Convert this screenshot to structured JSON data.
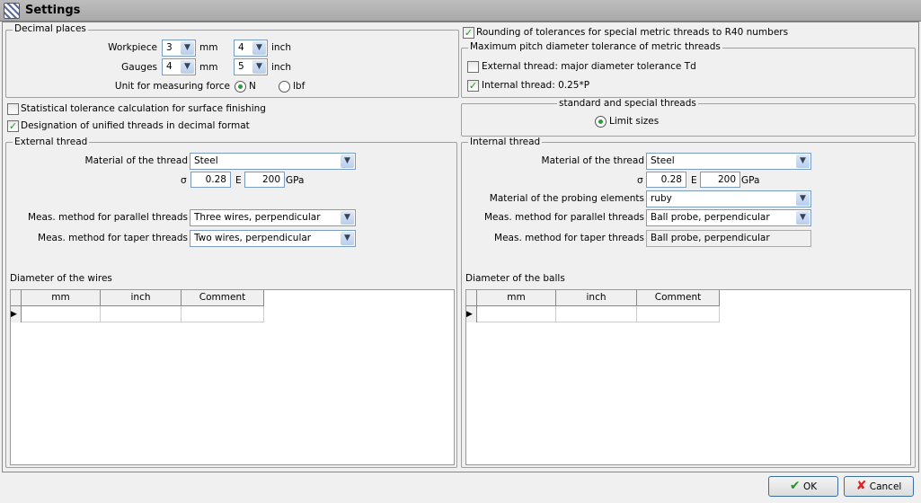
{
  "window": {
    "title": "Settings"
  },
  "decimal": {
    "legend": "Decimal places",
    "workpiece_label": "Workpiece",
    "workpiece_mm": "3",
    "workpiece_inch": "4",
    "gauges_label": "Gauges",
    "gauges_mm": "4",
    "gauges_inch": "5",
    "mm": "mm",
    "inch": "inch",
    "force_label": "Unit for measuring force",
    "force_n": "N",
    "force_lbf": "lbf",
    "force_selected": "N"
  },
  "options": {
    "statistical": "Statistical tolerance calculation for surface finishing",
    "statistical_checked": false,
    "unified": "Designation of unified threads in decimal format",
    "unified_checked": true,
    "rounding": "Rounding of tolerances for special metric threads to R40 numbers",
    "rounding_checked": true
  },
  "pitch": {
    "legend": "Maximum pitch diameter tolerance of metric threads",
    "external": "External thread: major diameter tolerance Td",
    "external_checked": false,
    "internal": "Internal thread: 0.25*P",
    "internal_checked": true
  },
  "spec": {
    "legend": "standard and special threads",
    "limit": "Limit sizes"
  },
  "external": {
    "legend": "External thread",
    "material_label": "Material of the thread",
    "material": "Steel",
    "sigma_label": "σ",
    "sigma": "0.28",
    "e_label": "E",
    "e": "200",
    "gpa": "GPa",
    "parallel_label": "Meas. method for parallel threads",
    "parallel": "Three wires, perpendicular",
    "taper_label": "Meas. method for taper threads",
    "taper": "Two wires, perpendicular",
    "table_title": "Diameter of the wires",
    "columns": [
      "mm",
      "inch",
      "Comment"
    ]
  },
  "internal": {
    "legend": "Internal thread",
    "material_label": "Material of the thread",
    "material": "Steel",
    "sigma_label": "σ",
    "sigma": "0.28",
    "e_label": "E",
    "e": "200",
    "gpa": "GPa",
    "probing_label": "Material of the probing elements",
    "probing": "ruby",
    "parallel_label": "Meas. method for parallel threads",
    "parallel": "Ball probe, perpendicular",
    "taper_label": "Meas. method for taper threads",
    "taper": "Ball probe, perpendicular",
    "table_title": "Diameter of the balls",
    "columns": [
      "mm",
      "inch",
      "Comment"
    ]
  },
  "buttons": {
    "ok": "OK",
    "cancel": "Cancel"
  }
}
